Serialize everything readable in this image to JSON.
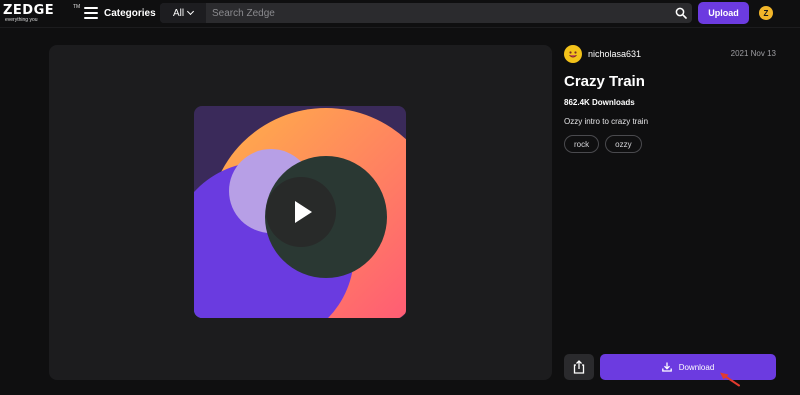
{
  "header": {
    "logo": "ZEDGE",
    "logo_tagline": "everything you",
    "logo_tm": "TM",
    "categories_label": "Categories",
    "search_scope": "All",
    "search_placeholder": "Search Zedge",
    "upload_label": "Upload",
    "user_initial": "Z"
  },
  "ringtone": {
    "uploader": "nicholasa631",
    "date": "2021 Nov 13",
    "title": "Crazy Train",
    "downloads": "862.4K Downloads",
    "description": "Ozzy intro to crazy train",
    "tags": [
      "rock",
      "ozzy"
    ]
  },
  "actions": {
    "download_label": "Download"
  },
  "colors": {
    "accent": "#6c3be0",
    "background": "#0f0f10",
    "panel": "#1c1c1e",
    "art_background": "#3a2a5a",
    "art_orange_gradient": [
      "#ffb347",
      "#ff4f7b"
    ],
    "art_purple": "#6a3be0",
    "art_lavender": "#b79fe6",
    "art_dark": "#2a3833",
    "art_teal": "#1aa86a",
    "cursor_arrow": "#e23b2e"
  },
  "icons": {
    "menu": "hamburger-icon",
    "search": "search-icon",
    "play": "play-icon",
    "share": "share-icon",
    "download": "download-icon"
  }
}
